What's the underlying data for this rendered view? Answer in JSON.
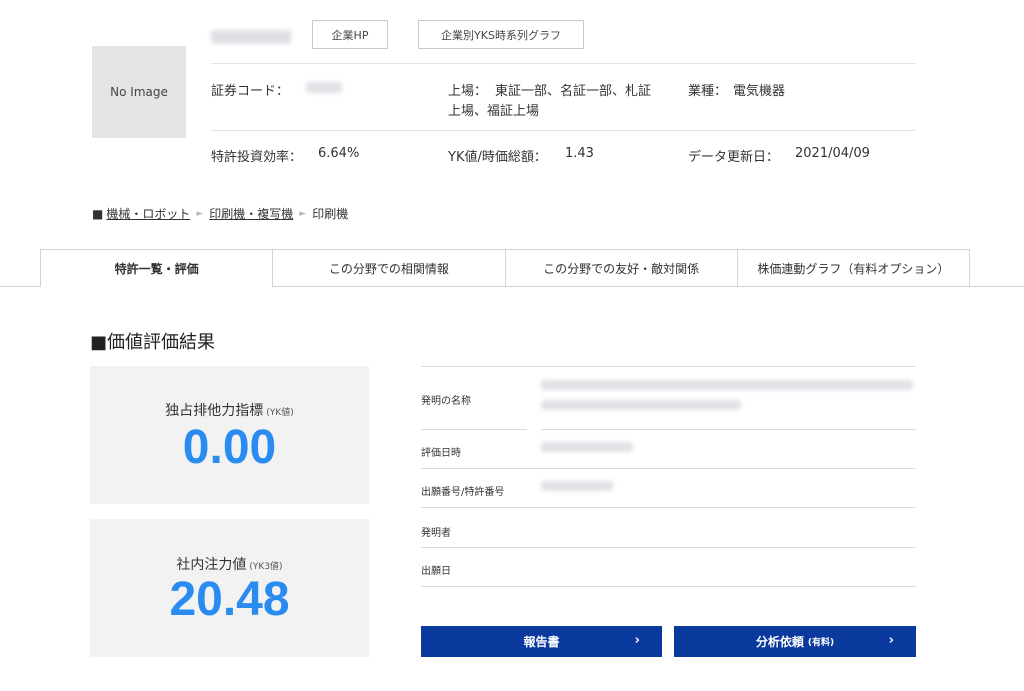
{
  "company": {
    "image_placeholder": "No Image",
    "hp_button": "企業HP",
    "graph_button": "企業別YKS時系列グラフ",
    "securities_code_label": "証券コード：",
    "listing_label": "上場：",
    "listing_value_line1": "東証一部、名証一部、札証",
    "listing_value_line2": "上場、福証上場",
    "industry_label": "業種：",
    "industry_value": "電気機器",
    "patent_efficiency_label": "特許投資効率：",
    "patent_efficiency_value": "6.64%",
    "yk_market_label": "YK値/時価総額：",
    "yk_market_value": "1.43",
    "updated_label": "データ更新日：",
    "updated_value": "2021/04/09"
  },
  "breadcrumb": {
    "marker": "■",
    "items": [
      "機械・ロボット",
      "印刷機・複写機",
      "印刷機"
    ],
    "separator": "►"
  },
  "tabs": [
    {
      "label": "特許一覧・評価",
      "active": true
    },
    {
      "label": "この分野での相関情報",
      "active": false
    },
    {
      "label": "この分野での友好・敵対関係",
      "active": false
    },
    {
      "label": "株価連動グラフ（有料オプション）",
      "active": false
    }
  ],
  "section": {
    "title": "■価値評価結果"
  },
  "cards": {
    "yk": {
      "label": "独占排他力指標",
      "sub": "(YK値)",
      "value": "0.00"
    },
    "yk3": {
      "label": "社内注力値",
      "sub": "(YK3値)",
      "value": "20.48"
    }
  },
  "details": {
    "invention_name": "発明の名称",
    "evaluation_date": "評価日時",
    "application_number": "出願番号/特許番号",
    "inventor": "発明者",
    "filing_date": "出願日"
  },
  "actions": {
    "report": "報告書",
    "analysis": "分析依頼",
    "analysis_note": "(有料)",
    "chevron": "›"
  },
  "colors": {
    "accent_blue": "#2a8cf0",
    "button_navy": "#0b3a9e"
  }
}
